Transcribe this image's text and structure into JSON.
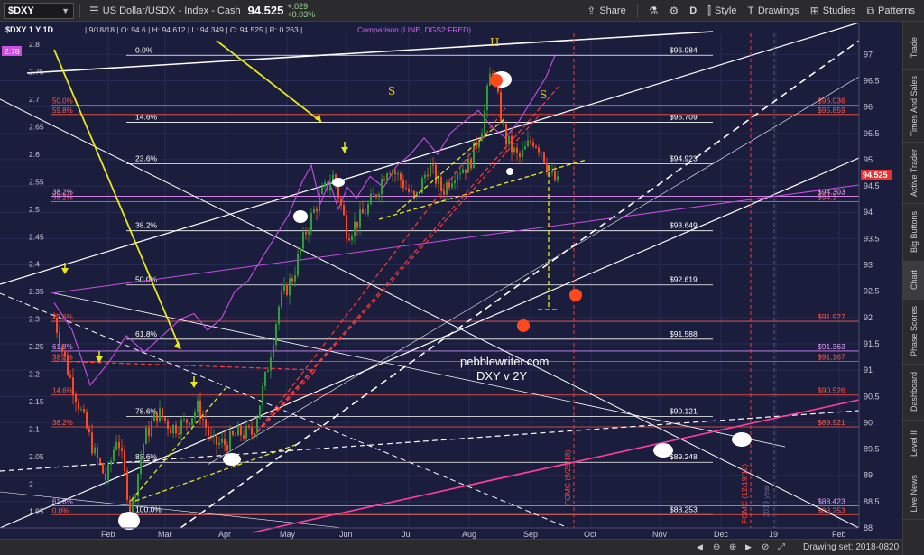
{
  "toolbar": {
    "symbol": "$DXY",
    "description": "US Dollar/USDX - Index - Cash",
    "price": "94.525",
    "change": "+.029",
    "change_pct": "+0.03%",
    "buttons": {
      "share": "Share",
      "period": "D",
      "style": "Style",
      "drawings": "Drawings",
      "studies": "Studies",
      "patterns": "Patterns"
    }
  },
  "legend": {
    "symbol_tf": "$DXY 1 Y 1D",
    "ohlc": "| 9/18/18 | O: 94.6 | H: 94.612 | L: 94.349 | C: 94.525 | R: 0.263 |",
    "comparison": "Comparison (LINE, DGS2:FRED)",
    "left_tag": "2.78"
  },
  "sidebar": {
    "tabs": [
      "Trade",
      "Times And Sales",
      "Active Trader",
      "Big Buttons",
      "Chart",
      "Phase Scores",
      "Dashboard",
      "Level II",
      "Live News"
    ],
    "active": "Chart"
  },
  "bottom": {
    "drawing_set": "Drawing set: 2018-0820"
  },
  "colors": {
    "background": "#1b1d3d",
    "up_candle": "#2f9e35",
    "down_candle": "#ff4a1f",
    "comparison_line": "#c94fe6",
    "fib_red": "#ff5a4a",
    "channel_white": "#ffffff",
    "trend_yellow": "#e8e81a",
    "pink_line": "#ff3fa0",
    "price_tag_bg": "#e8312a"
  },
  "chart_data": {
    "type": "candlestick",
    "watermark_left": "pebblewriter.com",
    "watermark_right": "DXY v 2Y",
    "x_ticks": [
      "Feb",
      "Mar",
      "Apr",
      "May",
      "Jun",
      "Jul",
      "Aug",
      "Sep",
      "Oct",
      "Nov",
      "Dec",
      "19",
      "Feb"
    ],
    "y_right": {
      "min": 88.0,
      "max": 97.4,
      "ticks": [
        "97",
        "96.5",
        "96",
        "95.5",
        "95",
        "94.5",
        "94",
        "93.5",
        "93",
        "92.5",
        "92",
        "91.5",
        "91",
        "90.5",
        "90",
        "89.5",
        "89",
        "88.5",
        "88"
      ]
    },
    "y_left": {
      "min": 1.92,
      "max": 2.82,
      "ticks": [
        "2.8",
        "2.75",
        "2.7",
        "2.65",
        "2.6",
        "2.55",
        "2.5",
        "2.45",
        "2.4",
        "2.35",
        "2.3",
        "2.25",
        "2.2",
        "2.15",
        "2.1",
        "2.05",
        "2",
        "1.95"
      ]
    },
    "last_price": "94.525",
    "fib_levels_white": [
      {
        "pct": "0.0%",
        "value": "96.984"
      },
      {
        "pct": "14.6%",
        "value": "95.709"
      },
      {
        "pct": "23.6%",
        "value": "94.923"
      },
      {
        "pct": "38.2%",
        "value": "93.649"
      },
      {
        "pct": "50.0%",
        "value": "92.619"
      },
      {
        "pct": "61.8%",
        "value": "91.588"
      },
      {
        "pct": "78.6%",
        "value": "90.121"
      },
      {
        "pct": "88.6%",
        "value": "89.248"
      },
      {
        "pct": "100.0%",
        "value": "88.253"
      }
    ],
    "fib_levels_red": [
      {
        "pct": "50.0%",
        "value": "96.036"
      },
      {
        "pct": "59.8%",
        "value": "95.859"
      },
      {
        "pct": "38.2%",
        "value": "94.303"
      },
      {
        "pct": "38.2%",
        "value": "94.2"
      },
      {
        "pct": "23.6%",
        "value": "91.927"
      },
      {
        "pct": "38.2%",
        "value": "91.167"
      },
      {
        "pct": "14.6%",
        "value": "90.526"
      },
      {
        "pct": "38.2%",
        "value": "89.921"
      },
      {
        "pct": "0.0%",
        "value": "88.253"
      }
    ],
    "violet_levels": [
      {
        "pct": "38.2%",
        "value": "94.303"
      },
      {
        "pct": "61.8%",
        "value": "91.363"
      },
      {
        "pct": "61.8%",
        "value": "88.423"
      }
    ],
    "annotations": {
      "head": "H",
      "shoulder_left": "S",
      "shoulder_right": "S",
      "fomc1": "FOMC (9/25/18)",
      "fomc2": "FOMC (12/19/18)",
      "fomc3": "2019 year"
    }
  }
}
